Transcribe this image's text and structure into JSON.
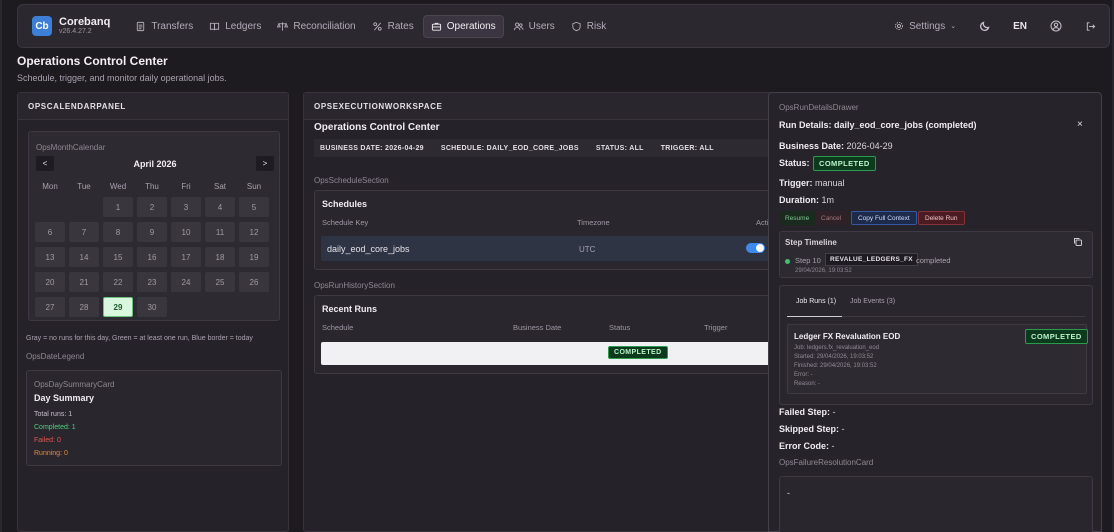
{
  "app": {
    "logo": "Cb",
    "name": "Corebanq",
    "version": "v26.4.27.2"
  },
  "nav": {
    "links": [
      {
        "label": "Transfers",
        "icon": "document-icon",
        "active": false
      },
      {
        "label": "Ledgers",
        "icon": "book-icon",
        "active": false
      },
      {
        "label": "Reconciliation",
        "icon": "scale-icon",
        "active": false
      },
      {
        "label": "Rates",
        "icon": "percent-icon",
        "active": false
      },
      {
        "label": "Operations",
        "icon": "briefcase-icon",
        "active": true
      },
      {
        "label": "Users",
        "icon": "users-icon",
        "active": false
      },
      {
        "label": "Risk",
        "icon": "shield-icon",
        "active": false
      }
    ],
    "settings_label": "Settings",
    "language": "EN"
  },
  "page": {
    "title": "Operations Control Center",
    "subtitle": "Schedule, trigger, and monitor daily operational jobs."
  },
  "calendar_panel": {
    "header": "OPSCALENDARPANEL",
    "calendar_label": "OpsMonthCalendar",
    "prev": "<",
    "next": ">",
    "month": "April 2026",
    "days_of_week": [
      "Mon",
      "Tue",
      "Wed",
      "Thu",
      "Fri",
      "Sat",
      "Sun"
    ],
    "weeks": [
      [
        "",
        "",
        "1",
        "2",
        "3",
        "4",
        "5"
      ],
      [
        "6",
        "7",
        "8",
        "9",
        "10",
        "11",
        "12"
      ],
      [
        "13",
        "14",
        "15",
        "16",
        "17",
        "18",
        "19"
      ],
      [
        "20",
        "21",
        "22",
        "23",
        "24",
        "25",
        "26"
      ],
      [
        "27",
        "28",
        "29",
        "30",
        "",
        "",
        ""
      ]
    ],
    "today": "29",
    "legend_text": "Gray = no runs for this day, Green = at least one run, Blue border = today",
    "legend_name": "OpsDateLegend",
    "summary": {
      "label": "OpsDaySummaryCard",
      "title": "Day Summary",
      "total": "Total runs: 1",
      "completed": "Completed: 1",
      "failed": "Failed: 0",
      "running": "Running: 0"
    }
  },
  "workspace": {
    "header": "OPSEXECUTIONWORKSPACE",
    "title": "Operations Control Center",
    "filters": {
      "business_date": "BUSINESS DATE: 2026-04-29",
      "schedule": "SCHEDULE: DAILY_EOD_CORE_JOBS",
      "status": "STATUS: ALL",
      "trigger": "TRIGGER: ALL"
    },
    "schedule_section": {
      "label": "OpsScheduleSection",
      "title": "Schedules",
      "columns": [
        "Schedule Key",
        "Timezone",
        "Acti"
      ],
      "rows": [
        {
          "key": "daily_eod_core_jobs",
          "timezone": "UTC",
          "active": true
        }
      ]
    },
    "history_section": {
      "label": "OpsRunHistorySection",
      "title": "Recent Runs",
      "columns": [
        "Schedule",
        "Business Date",
        "Status",
        "Trigger"
      ],
      "rows": [
        {
          "status": "COMPLETED"
        }
      ]
    }
  },
  "drawer": {
    "label": "OpsRunDetailsDrawer",
    "title": "Run Details: daily_eod_core_jobs (completed)",
    "close": "×",
    "business_date_label": "Business Date:",
    "business_date": "2026-04-29",
    "status_label": "Status:",
    "status": "COMPLETED",
    "trigger_label": "Trigger:",
    "trigger": "manual",
    "duration_label": "Duration:",
    "duration": "1m",
    "actions": [
      "Resume",
      "Cancel",
      "Copy Full Context",
      "Delete Run"
    ],
    "timeline": {
      "title": "Step Timeline",
      "step": "Step 10",
      "code": "REVALUE_LEDGERS_FX",
      "status": "completed",
      "time": "29/04/2026, 19:03:52"
    },
    "tabs": [
      "Job Runs (1)",
      "Job Events (3)"
    ],
    "job": {
      "title": "Ledger FX Revaluation EOD",
      "status": "COMPLETED",
      "job_line": "Job: ledgers.fx_revaluation_eod",
      "started": "Started: 29/04/2026, 19:03:52",
      "finished": "Finished: 29/04/2026, 19:03:52",
      "error": "Error: -",
      "reason": "Reason: -"
    },
    "failed_step_label": "Failed Step:",
    "failed_step": "-",
    "skipped_step_label": "Skipped Step:",
    "skipped_step": "-",
    "error_code_label": "Error Code:",
    "error_code": "-",
    "failure_card_label": "OpsFailureResolutionCard",
    "failure_text": "-"
  }
}
